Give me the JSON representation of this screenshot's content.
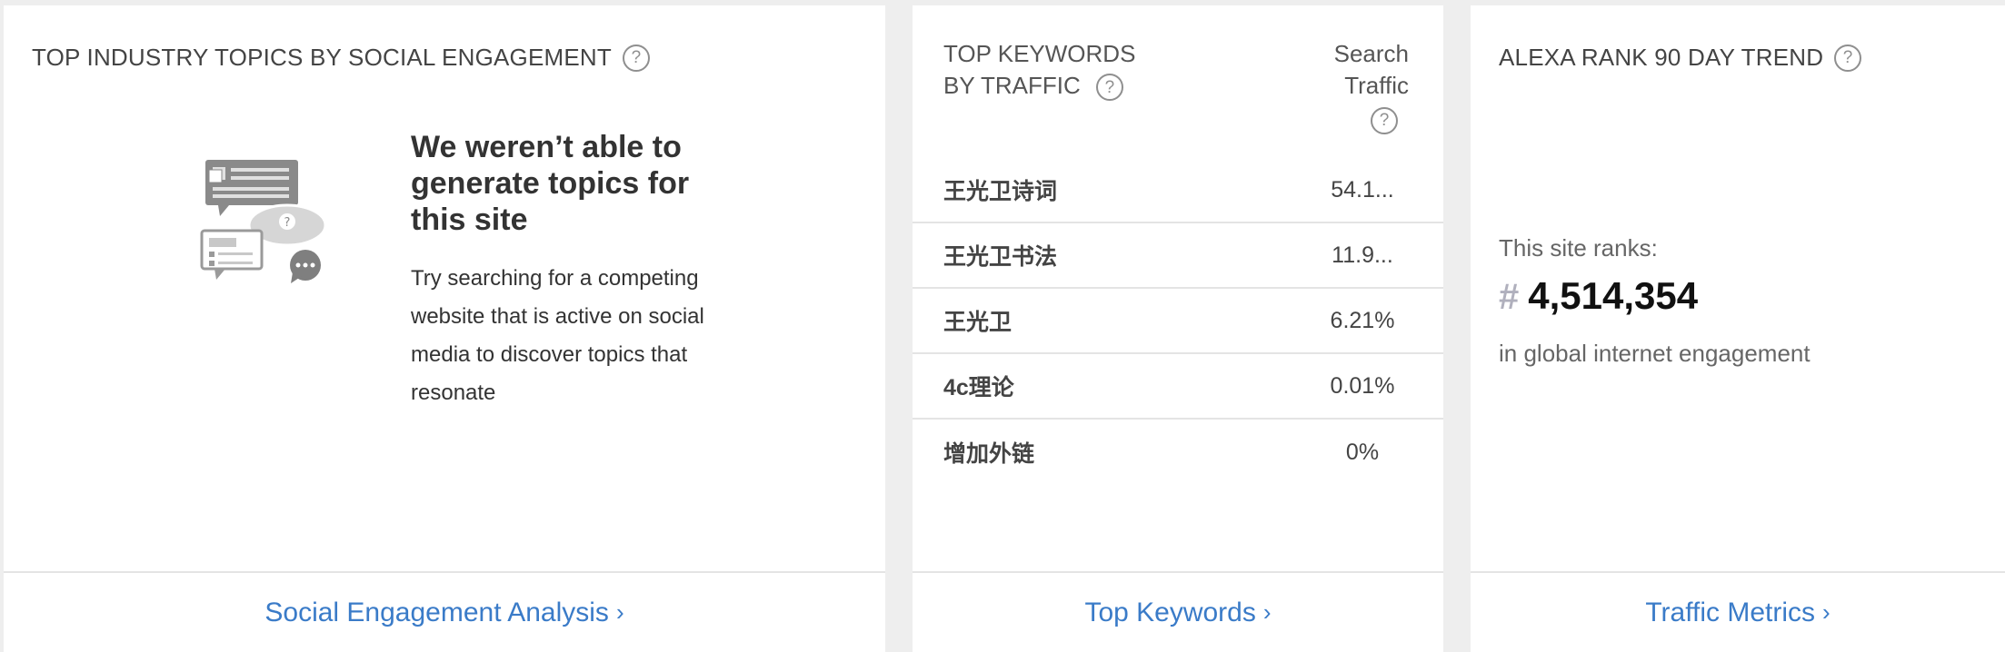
{
  "topics_card": {
    "title": "TOP INDUSTRY TOPICS BY SOCIAL ENGAGEMENT",
    "help_glyph": "?",
    "empty_heading": "We weren’t able to generate topics for this site",
    "empty_body": "Try searching for a competing website that is active on social media to discover topics that resonate",
    "footer_link": "Social Engagement Analysis",
    "illustration_icon": "chat-bubbles-question-icon"
  },
  "keywords_card": {
    "title": "TOP KEYWORDS BY TRAFFIC",
    "column_header": "Search Traffic",
    "help_glyph": "?",
    "rows": [
      {
        "term": "王光卫诗词",
        "share": "54.1..."
      },
      {
        "term": "王光卫书法",
        "share": "11.9..."
      },
      {
        "term": "王光卫",
        "share": "6.21%"
      },
      {
        "term": "4c理论",
        "share": "0.01%"
      },
      {
        "term": "增加外链",
        "share": "0%"
      }
    ],
    "footer_link": "Top Keywords"
  },
  "alexa_card": {
    "title": "ALEXA RANK 90 DAY TREND",
    "help_glyph": "?",
    "rank_intro": "This site ranks:",
    "rank_hash": "#",
    "rank_value": "4,514,354",
    "rank_outro": "in global internet engagement",
    "footer_link": "Traffic Metrics"
  },
  "colors": {
    "link": "#3a7bc8",
    "page_background": "#eeeeee",
    "card_background": "#ffffff",
    "divider": "#e4e4e4"
  },
  "icons": {
    "help": "question-circle-icon",
    "chevron": "chevron-right-icon"
  }
}
